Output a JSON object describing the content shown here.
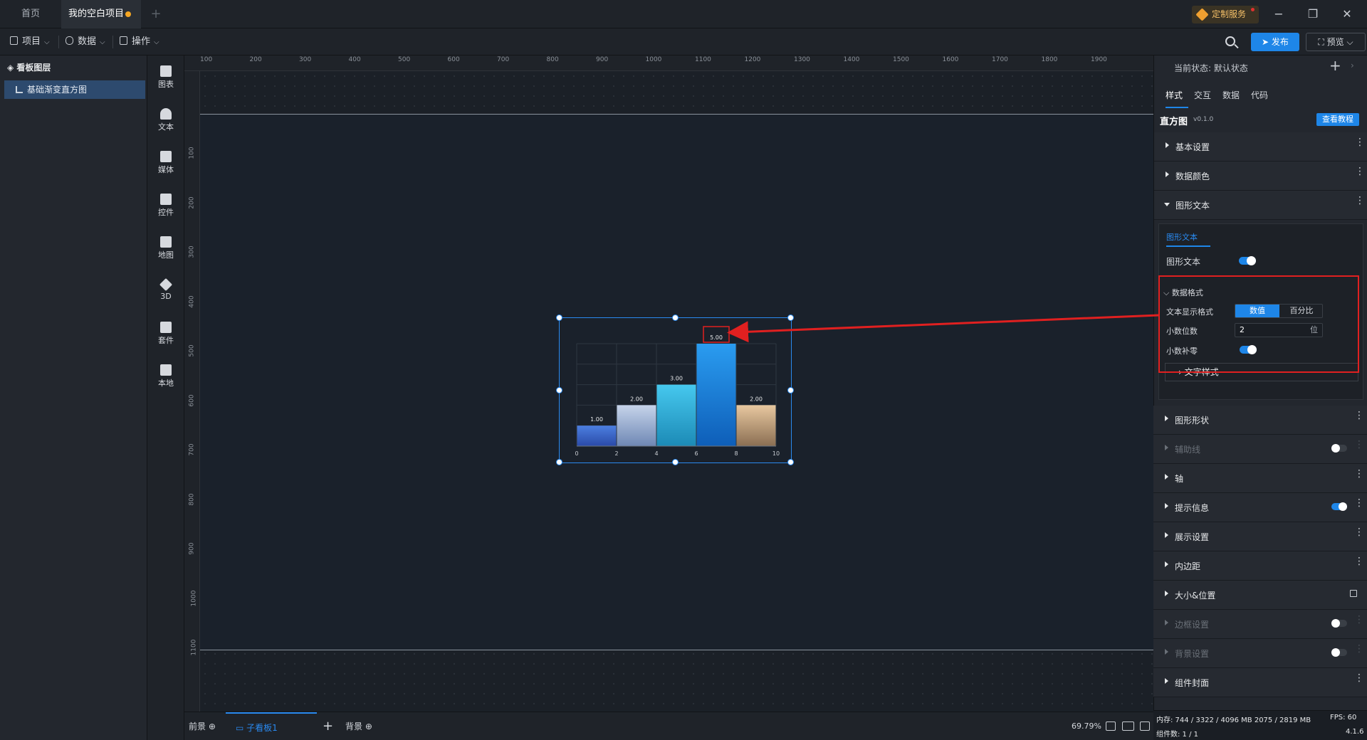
{
  "tabs": {
    "home": "首页",
    "project": "我的空白项目",
    "add": "+"
  },
  "custom_service": "定制服务",
  "window": {
    "minimize": "−",
    "restore": "❐",
    "close": "✕"
  },
  "toolbar": {
    "project": "项目",
    "data": "数据",
    "operation": "操作",
    "publish": "发布",
    "preview": "预览"
  },
  "layers": {
    "title": "看板图层",
    "item": "基础渐变直方图"
  },
  "components": [
    "图表",
    "文本",
    "媒体",
    "控件",
    "地图",
    "3D",
    "套件",
    "本地"
  ],
  "ruler": {
    "top": [
      "100",
      "200",
      "300",
      "400",
      "500",
      "600",
      "700",
      "800",
      "900",
      "1000",
      "1100",
      "1200",
      "1300",
      "1400",
      "1500",
      "1600",
      "1700",
      "1800",
      "1900"
    ],
    "left": [
      "100",
      "200",
      "300",
      "400",
      "500",
      "600",
      "700",
      "800",
      "900",
      "1000",
      "1100"
    ]
  },
  "chart_data": {
    "type": "bar",
    "x": [
      0,
      2,
      4,
      6,
      8,
      10
    ],
    "bins": [
      [
        0,
        2
      ],
      [
        2,
        4
      ],
      [
        4,
        6
      ],
      [
        6,
        8
      ],
      [
        8,
        10
      ]
    ],
    "values": [
      1,
      2,
      3,
      5,
      2
    ],
    "labels": [
      "1.00",
      "2.00",
      "3.00",
      "5.00",
      "2.00"
    ],
    "xticks": [
      "0",
      "2",
      "4",
      "6",
      "8",
      "10"
    ],
    "ylim": [
      0,
      5
    ],
    "colors": [
      [
        "#4c7fe0",
        "#2a4aa8"
      ],
      [
        "#c6d4ea",
        "#6e87b4"
      ],
      [
        "#46c8ee",
        "#1c8ab6"
      ],
      [
        "#2a9cf0",
        "#0e5eb8"
      ],
      [
        "#e8c8a0",
        "#8a6e52"
      ]
    ],
    "grid": true
  },
  "bottom": {
    "front": "前景",
    "sub": "子看板1",
    "add": "+",
    "back": "背景",
    "zoom": "69.79%"
  },
  "panel": {
    "state": "当前状态:  默认状态",
    "state_add": "+",
    "tabs": [
      "样式",
      "交互",
      "数据",
      "代码"
    ],
    "title": "直方图",
    "version": "v0.1.0",
    "tutorial": "查看教程",
    "sections_top": [
      "基本设置",
      "数据颜色",
      "图形文本"
    ],
    "gt_tab": "图形文本",
    "gt_toggle": "图形文本",
    "format_title": "数据格式",
    "display_format": "文本显示格式",
    "seg_value": "数值",
    "seg_percent": "百分比",
    "decimals_label": "小数位数",
    "decimals": "2",
    "decimals_unit": "位",
    "pad_zero": "小数补零",
    "text_style": "文字样式",
    "sections_bottom": [
      {
        "label": "图形形状",
        "dim": false,
        "toggle": null
      },
      {
        "label": "辅助线",
        "dim": true,
        "toggle": "off"
      },
      {
        "label": "轴",
        "dim": false,
        "toggle": null
      },
      {
        "label": "提示信息",
        "dim": false,
        "toggle": "on"
      },
      {
        "label": "展示设置",
        "dim": false,
        "toggle": null
      },
      {
        "label": "内边距",
        "dim": false,
        "toggle": null
      },
      {
        "label": "大小&位置",
        "dim": false,
        "toggle": null,
        "lock": true
      },
      {
        "label": "边框设置",
        "dim": true,
        "toggle": "off"
      },
      {
        "label": "背景设置",
        "dim": true,
        "toggle": "off"
      },
      {
        "label": "组件封面",
        "dim": false,
        "toggle": null
      }
    ]
  },
  "status": {
    "memory": "内存:  744 / 3322 / 4096 MB  2075 / 2819 MB",
    "fps": "FPS:  60",
    "count": "组件数: 1 / 1",
    "version": "4.1.6"
  },
  "colors": {
    "accent": "#1e86e8",
    "annotation": "#e02020"
  }
}
